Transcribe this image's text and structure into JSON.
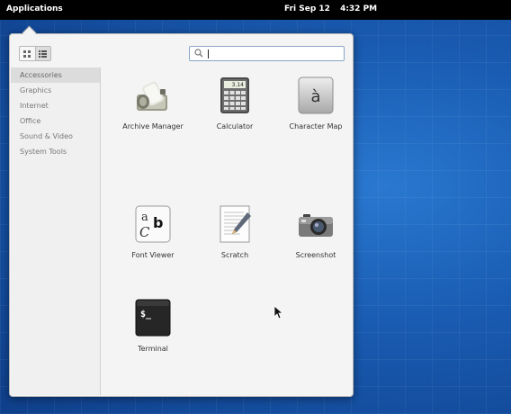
{
  "topbar": {
    "applications_label": "Applications",
    "date": "Fri Sep 12",
    "time": "4:32 PM"
  },
  "view_switch": {
    "grid_icon": "grid-view-icon",
    "list_icon": "category-view-icon"
  },
  "search": {
    "value": "",
    "icon": "search-icon"
  },
  "sidebar": {
    "items": [
      {
        "label": "Accessories",
        "selected": true
      },
      {
        "label": "Graphics"
      },
      {
        "label": "Internet"
      },
      {
        "label": "Office"
      },
      {
        "label": "Sound & Video"
      },
      {
        "label": "System Tools"
      }
    ]
  },
  "apps": [
    {
      "label": "Archive Manager",
      "icon": "archive-manager-icon"
    },
    {
      "label": "Calculator",
      "icon": "calculator-icon",
      "display": "3.14"
    },
    {
      "label": "Character Map",
      "icon": "character-map-icon",
      "glyph": "à"
    },
    {
      "label": "Font Viewer",
      "icon": "font-viewer-icon",
      "glyph_a": "a",
      "glyph_b": "b",
      "glyph_c": "C"
    },
    {
      "label": "Scratch",
      "icon": "scratch-icon"
    },
    {
      "label": "Screenshot",
      "icon": "screenshot-icon"
    },
    {
      "label": "Terminal",
      "icon": "terminal-icon",
      "prompt": "$_"
    }
  ],
  "colors": {
    "topbar_bg": "#000000",
    "desktop_blue": "#1a5db4",
    "popover_bg": "#f4f4f4",
    "selected_category": "#dcdcdc"
  }
}
